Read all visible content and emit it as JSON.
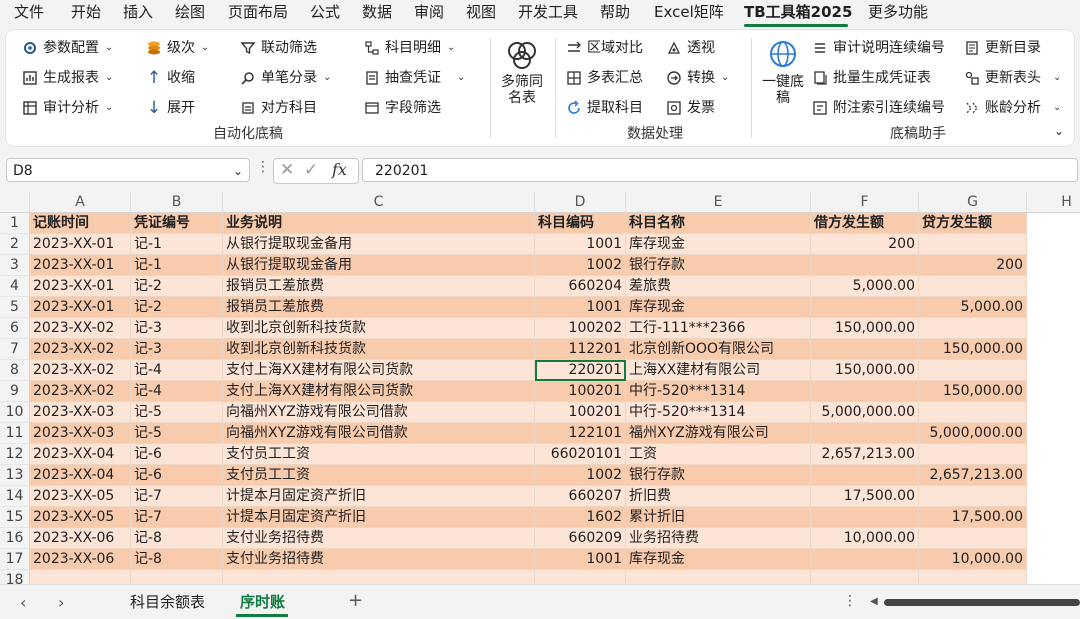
{
  "menu": {
    "items": [
      "文件",
      "开始",
      "插入",
      "绘图",
      "页面布局",
      "公式",
      "数据",
      "审阅",
      "视图",
      "开发工具",
      "帮助",
      "Excel矩阵",
      "TB工具箱2025",
      "更多功能"
    ],
    "active_index": 12
  },
  "ribbon": {
    "group1": {
      "label": "自动化底稿",
      "buttons": [
        "参数配置",
        "级次",
        "联动筛选",
        "科目明细",
        "生成报表",
        "收缩",
        "单笔分录",
        "抽查凭证",
        "审计分析",
        "展开",
        "对方科目",
        "字段筛选"
      ]
    },
    "multi_filter": "多筛同名表",
    "group2": {
      "label": "数据处理",
      "buttons": [
        "区域对比",
        "透视",
        "多表汇总",
        "转换",
        "提取科目",
        "发票"
      ]
    },
    "one_click": "一键底稿",
    "group3": {
      "label": "底稿助手",
      "buttons": [
        "审计说明连续编号",
        "更新目录",
        "批量生成凭证表",
        "更新表头",
        "附注索引连续编号",
        "账龄分析"
      ]
    }
  },
  "formula_bar": {
    "name_box": "D8",
    "fx": "fx",
    "value": "220201"
  },
  "columns": [
    "A",
    "B",
    "C",
    "D",
    "E",
    "F",
    "G",
    "H"
  ],
  "table": {
    "headers": [
      "记账时间",
      "凭证编号",
      "业务说明",
      "科目编码",
      "科目名称",
      "借方发生额",
      "贷方发生额"
    ],
    "rows": [
      [
        "2023-XX-01",
        "记-1",
        "从银行提取现金备用",
        "1001",
        "库存现金",
        "200",
        ""
      ],
      [
        "2023-XX-01",
        "记-1",
        "从银行提取现金备用",
        "1002",
        "银行存款",
        "",
        "200"
      ],
      [
        "2023-XX-01",
        "记-2",
        "报销员工差旅费",
        "660204",
        "差旅费",
        "5,000.00",
        ""
      ],
      [
        "2023-XX-01",
        "记-2",
        "报销员工差旅费",
        "1001",
        "库存现金",
        "",
        "5,000.00"
      ],
      [
        "2023-XX-02",
        "记-3",
        "收到北京创新科技货款",
        "100202",
        "工行-111***2366",
        "150,000.00",
        ""
      ],
      [
        "2023-XX-02",
        "记-3",
        "收到北京创新科技货款",
        "112201",
        "北京创新OOO有限公司",
        "",
        "150,000.00"
      ],
      [
        "2023-XX-02",
        "记-4",
        "支付上海XX建材有限公司货款",
        "220201",
        "上海XX建材有限公司",
        "150,000.00",
        ""
      ],
      [
        "2023-XX-02",
        "记-4",
        "支付上海XX建材有限公司货款",
        "100201",
        "中行-520***1314",
        "",
        "150,000.00"
      ],
      [
        "2023-XX-03",
        "记-5",
        "向福州XYZ游戏有限公司借款",
        "100201",
        "中行-520***1314",
        "5,000,000.00",
        ""
      ],
      [
        "2023-XX-03",
        "记-5",
        "向福州XYZ游戏有限公司借款",
        "122101",
        "福州XYZ游戏有限公司",
        "",
        "5,000,000.00"
      ],
      [
        "2023-XX-04",
        "记-6",
        "支付员工工资",
        "66020101",
        "工资",
        "2,657,213.00",
        ""
      ],
      [
        "2023-XX-04",
        "记-6",
        "支付员工工资",
        "1002",
        "银行存款",
        "",
        "2,657,213.00"
      ],
      [
        "2023-XX-05",
        "记-7",
        "计提本月固定资产折旧",
        "660207",
        "折旧费",
        "17,500.00",
        ""
      ],
      [
        "2023-XX-05",
        "记-7",
        "计提本月固定资产折旧",
        "1602",
        "累计折旧",
        "",
        "17,500.00"
      ],
      [
        "2023-XX-06",
        "记-8",
        "支付业务招待费",
        "660209",
        "业务招待费",
        "10,000.00",
        ""
      ],
      [
        "2023-XX-06",
        "记-8",
        "支付业务招待费",
        "1001",
        "库存现金",
        "",
        "10,000.00"
      ]
    ],
    "row_numbers": [
      "1",
      "2",
      "3",
      "4",
      "5",
      "6",
      "7",
      "8",
      "9",
      "10",
      "11",
      "12",
      "13",
      "14",
      "15",
      "16",
      "17",
      "18"
    ]
  },
  "sheets": {
    "tabs": [
      "科目余额表",
      "序时账"
    ],
    "active_index": 1,
    "add": "+"
  },
  "colors": {
    "accent": "#107c41",
    "row_dark": "#f8cbad",
    "row_light": "#fce4d6"
  }
}
